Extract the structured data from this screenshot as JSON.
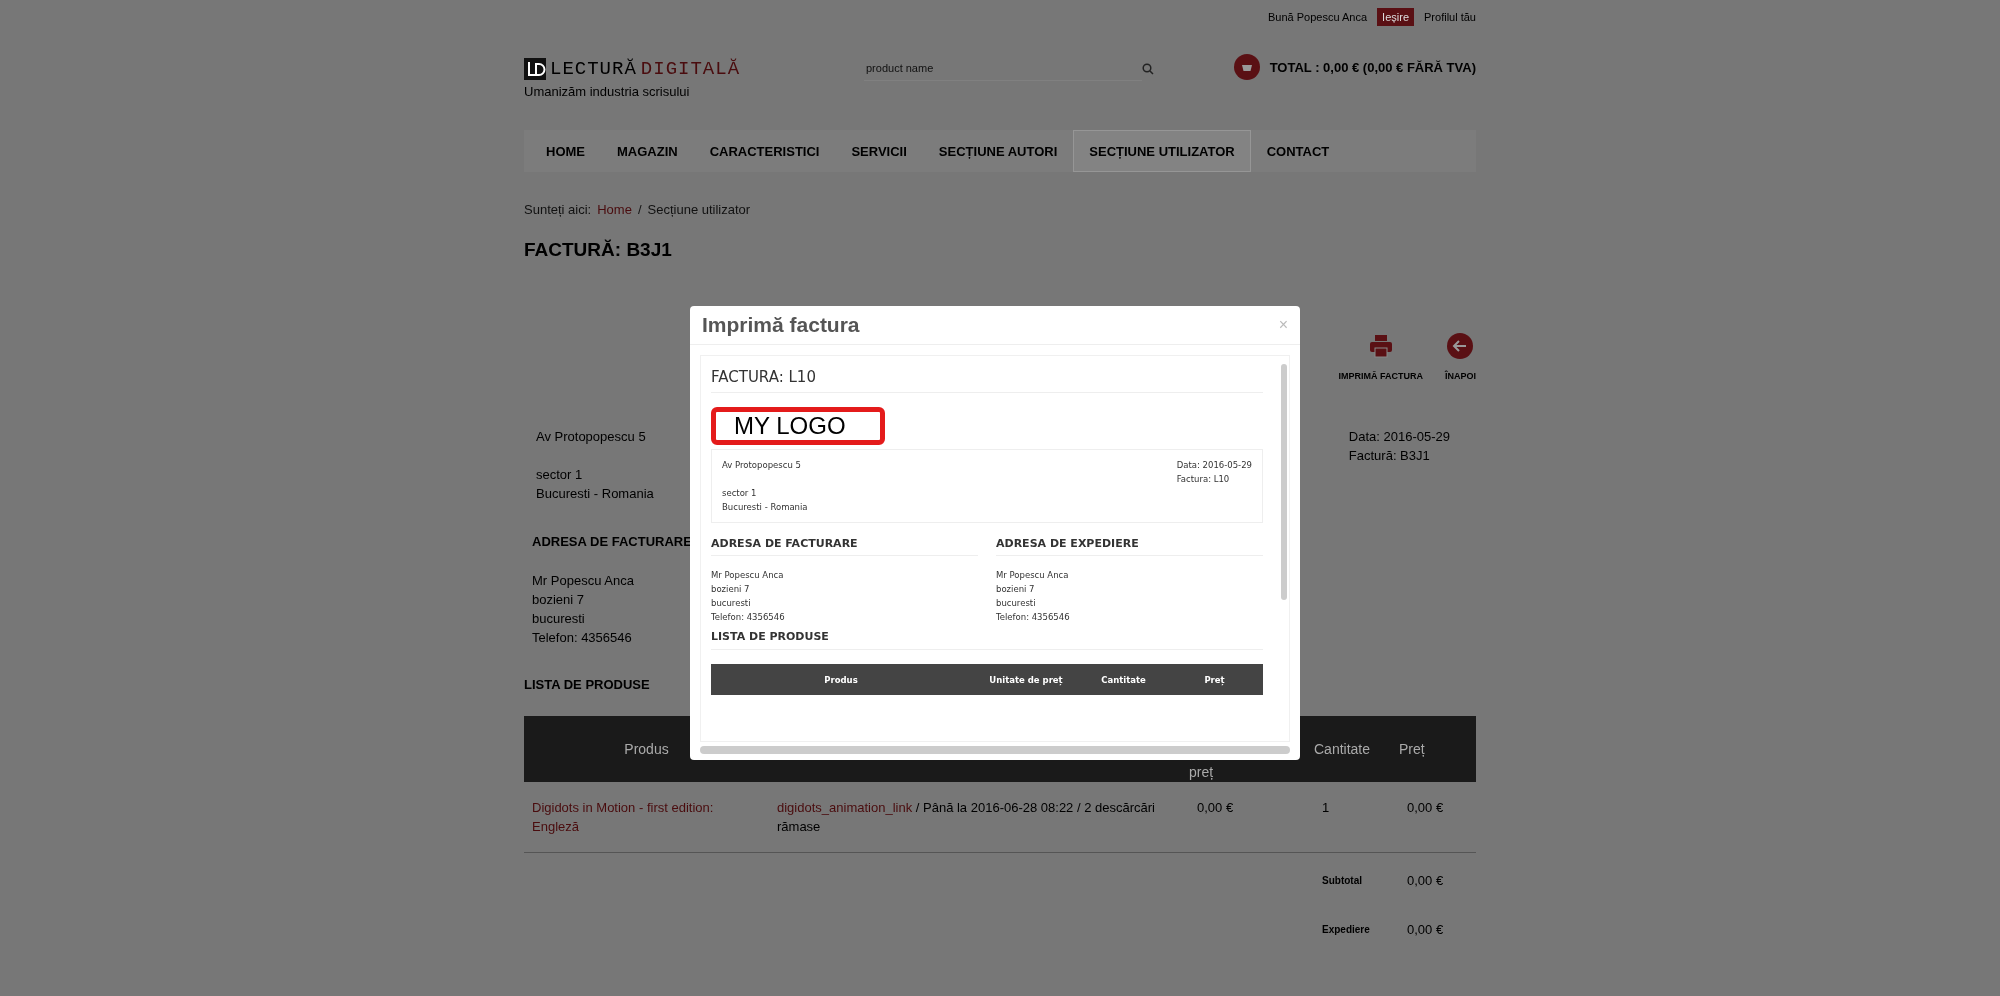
{
  "top_bar": {
    "greeting": "Bună Popescu Anca",
    "logout": "Ieșire",
    "profile": "Profilul tău"
  },
  "header": {
    "logo_word_1": "LECTURĂ",
    "logo_word_2": "DIGITALĂ",
    "tagline": "Umanizăm industria scrisului",
    "search": {
      "placeholder": "product name"
    },
    "cart_total": "TOTAL : 0,00 € (0,00 € FĂRĂ TVA)"
  },
  "nav": [
    {
      "label": "HOME",
      "selected": false
    },
    {
      "label": "MAGAZIN",
      "selected": false
    },
    {
      "label": "CARACTERISTICI",
      "selected": false
    },
    {
      "label": "SERVICII",
      "selected": false
    },
    {
      "label": "SECȚIUNE AUTORI",
      "selected": false
    },
    {
      "label": "SECȚIUNE UTILIZATOR",
      "selected": true
    },
    {
      "label": "CONTACT",
      "selected": false
    }
  ],
  "breadcrumb": {
    "label": "Sunteți aici:",
    "link": "Home",
    "separator": "/",
    "current": "Secțiune utilizator"
  },
  "page_title": "FACTURĂ: B3J1",
  "actions": [
    {
      "kind": "print",
      "label": "IMPRIMĂ FACTURA"
    },
    {
      "kind": "back",
      "label": "ÎNAPOI"
    }
  ],
  "seller": [
    [
      "Av Protopopescu 5"
    ],
    [
      "sector 1",
      "Bucuresti - Romania"
    ]
  ],
  "invoice_meta": [
    "Data: 2016-05-29",
    "Factură: B3J1"
  ],
  "billing": {
    "heading": "ADRESA DE FACTURARE",
    "lines": [
      "Mr Popescu Anca",
      "bozieni 7",
      "bucuresti",
      "Telefon: 4356546"
    ]
  },
  "products_heading": "LISTA DE PRODUSE",
  "table": {
    "columns": {
      "product": "Produs",
      "unit_price": "preț",
      "quantity": "Cantitate",
      "price": "Preț"
    },
    "rows": [
      {
        "product": "Digidots in Motion - first edition: Engleză",
        "link": "digidots_animation_link",
        "details": "/ Până la 2016-06-28 08:22 / 2 descărcări rămase",
        "unit_price": "0,00 €",
        "quantity": "1",
        "price": "0,00 €"
      }
    ],
    "totals": [
      {
        "label": "Subtotal",
        "value": "0,00 €"
      },
      {
        "label": "Expediere",
        "value": "0,00 €"
      }
    ]
  },
  "modal": {
    "title": "Imprimă factura",
    "close": "×",
    "document": {
      "title": "FACTURA: L10",
      "logo": "MY LOGO",
      "seller": [
        [
          "Av Protopopescu 5"
        ],
        [
          "sector 1",
          "Bucuresti - Romania"
        ]
      ],
      "meta": [
        "Data: 2016-05-29",
        "Factura: L10"
      ],
      "addresses": [
        {
          "heading": "ADRESA DE FACTURARE",
          "lines": [
            "Mr Popescu Anca",
            "bozieni 7",
            "bucuresti",
            "Telefon: 4356546"
          ]
        },
        {
          "heading": "ADRESA DE EXPEDIERE",
          "lines": [
            "Mr Popescu Anca",
            "bozieni 7",
            "bucuresti",
            "Telefon: 4356546"
          ]
        }
      ],
      "products_heading": "LISTA DE PRODUSE",
      "columns": [
        "Produs",
        "Unitate de preț",
        "Cantitate",
        "Preț"
      ]
    }
  }
}
